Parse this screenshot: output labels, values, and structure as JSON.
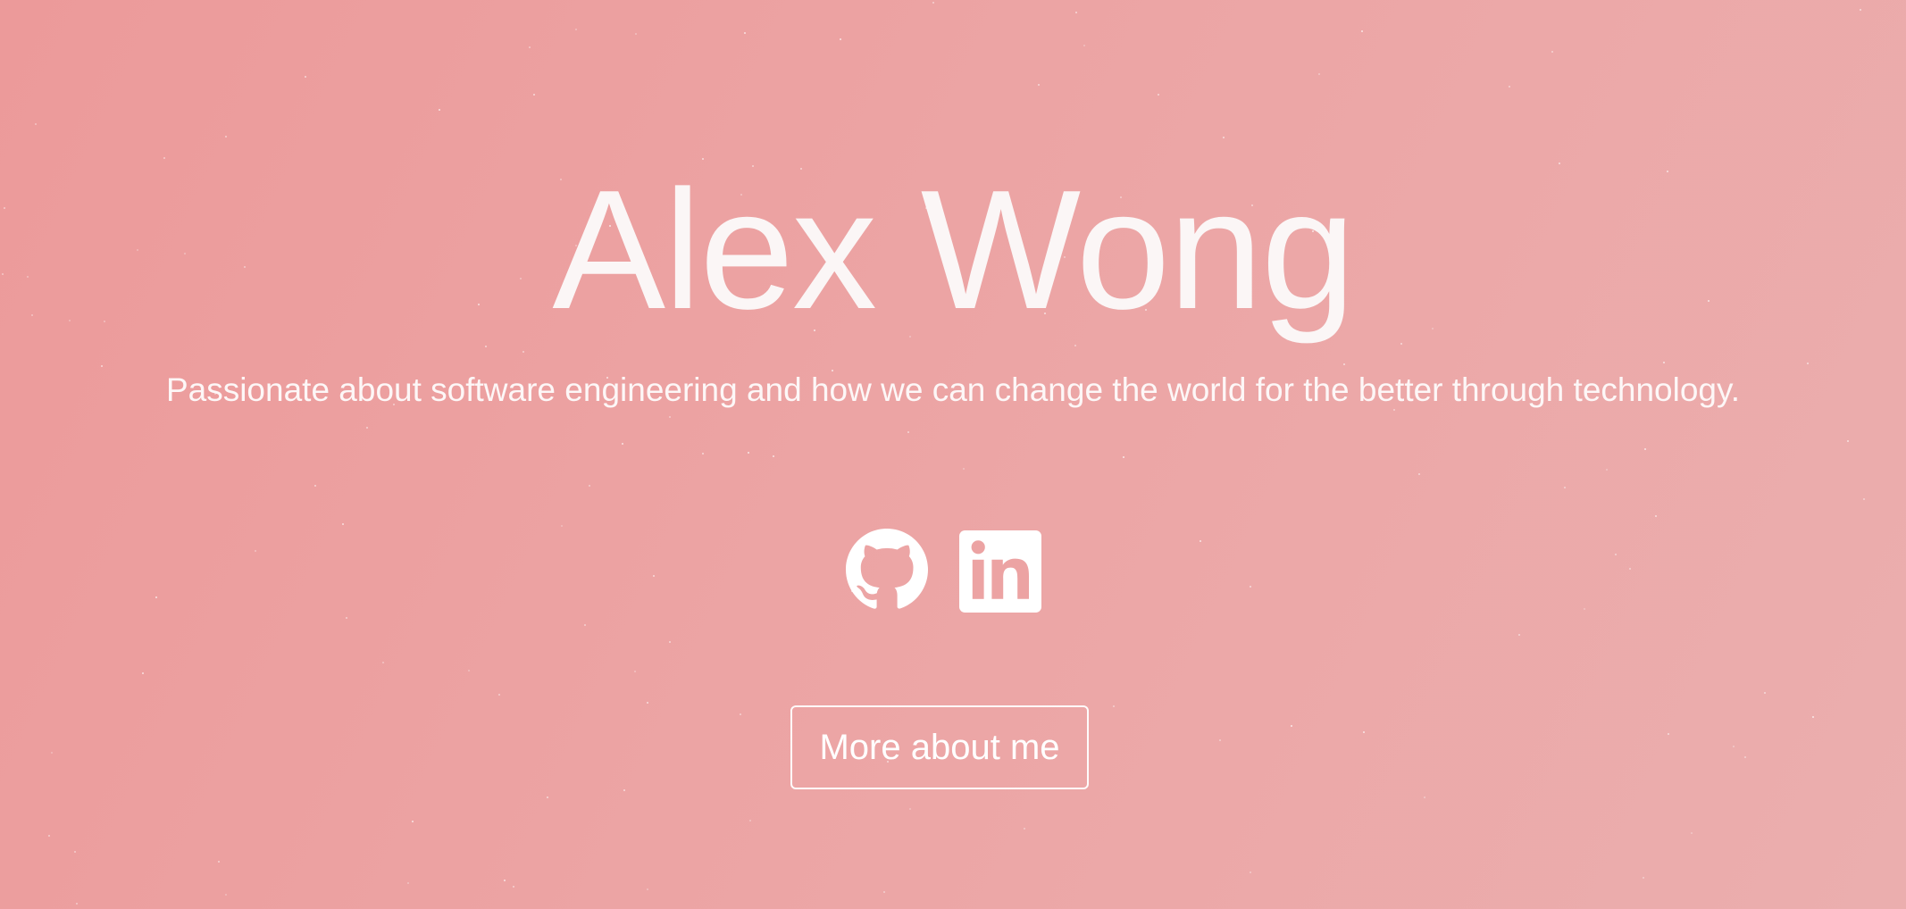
{
  "hero": {
    "name": "Alex Wong",
    "tagline": "Passionate about software engineering and how we can change the world for the better through technology.",
    "cta_label": "More about me"
  },
  "socials": [
    {
      "icon": "github-icon",
      "label": "GitHub"
    },
    {
      "icon": "linkedin-icon",
      "label": "LinkedIn"
    }
  ],
  "colors": {
    "background_start": "#ec9a9a",
    "background_end": "#ebaeae",
    "text": "#ffffff"
  }
}
